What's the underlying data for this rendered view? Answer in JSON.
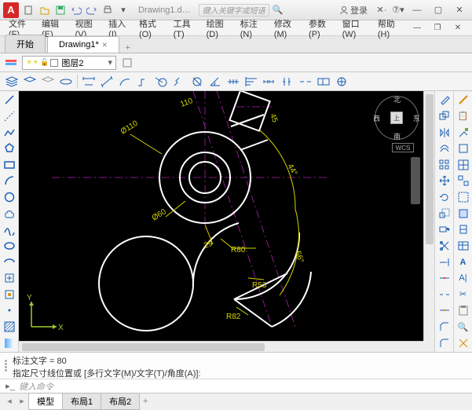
{
  "title": {
    "doc": "Drawing1.d…"
  },
  "search": {
    "placeholder": "键入关键字或短语"
  },
  "login": {
    "label": "登录"
  },
  "menu": {
    "file": "文件(F)",
    "edit": "编辑(E)",
    "view": "视图(V)",
    "insert": "插入(I)",
    "format": "格式(O)",
    "tools": "工具(T)",
    "draw": "绘图(D)",
    "dimension": "标注(N)",
    "modify": "修改(M)",
    "param": "参数(P)",
    "window": "窗口(W)",
    "help": "帮助(H)"
  },
  "tabs": {
    "start": "开始",
    "drawing": "Drawing1*"
  },
  "layer": {
    "current": "图层2"
  },
  "compass": {
    "n": "北",
    "s": "南",
    "e": "东",
    "w": "西",
    "top": "上"
  },
  "wcs": "WCS",
  "ucs": {
    "x": "X",
    "y": "Y"
  },
  "dims": {
    "d110": "Ø110",
    "d60": "Ø60",
    "a44": "44°",
    "a56": "56°",
    "r80": "R80",
    "r53": "R53",
    "r82": "R82",
    "d29": "29",
    "t110": "110",
    "t45": "45"
  },
  "cmd": {
    "line1": "标注文字 = 80",
    "line2": "指定尺寸线位置或 [多行文字(M)/文字(T)/角度(A)]:",
    "prompt": "键入命令"
  },
  "status": {
    "model": "模型",
    "layout1": "布局1",
    "layout2": "布局2"
  }
}
